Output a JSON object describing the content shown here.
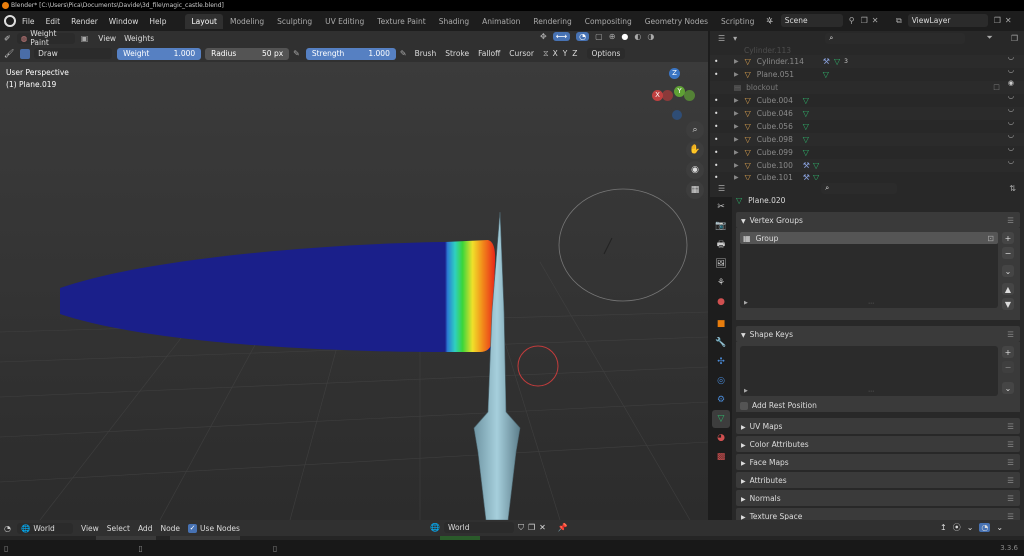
{
  "window": {
    "title": "Blender* [C:\\Users\\Pica\\Documents\\Davide\\3d_file\\magic_castle.blend]"
  },
  "menus": [
    "File",
    "Edit",
    "Render",
    "Window",
    "Help"
  ],
  "workspaces": [
    "Layout",
    "Modeling",
    "Sculpting",
    "UV Editing",
    "Texture Paint",
    "Shading",
    "Animation",
    "Rendering",
    "Compositing",
    "Geometry Nodes",
    "Scripting"
  ],
  "active_workspace": "Layout",
  "scene": "Scene",
  "view_layer": "ViewLayer",
  "toolbar": {
    "mode": "Weight Paint",
    "view": "View",
    "weights": "Weights"
  },
  "tool_settings": {
    "brush_name": "Draw",
    "weight_label": "Weight",
    "weight_value": "1.000",
    "radius_label": "Radius",
    "radius_value": "50 px",
    "strength_label": "Strength",
    "strength_value": "1.000",
    "brush": "Brush",
    "stroke": "Stroke",
    "falloff": "Falloff",
    "cursor": "Cursor",
    "x": "X",
    "y": "Y",
    "z": "Z",
    "options": "Options"
  },
  "viewport": {
    "perspective": "User Perspective",
    "object": "(1) Plane.019"
  },
  "gizmo": {
    "z": "Z",
    "y": "Y",
    "x": "X"
  },
  "outliner": {
    "rows": [
      {
        "name": "Cylinder.114",
        "extra": "3"
      },
      {
        "name": "Plane.051",
        "extra": ""
      },
      {
        "name": "blockout",
        "collection": true
      },
      {
        "name": "Cube.004"
      },
      {
        "name": "Cube.046"
      },
      {
        "name": "Cube.056"
      },
      {
        "name": "Cube.098"
      },
      {
        "name": "Cube.099"
      },
      {
        "name": "Cube.100"
      },
      {
        "name": "Cube.101"
      }
    ]
  },
  "properties": {
    "object_name": "Plane.020",
    "vertex_groups": "Vertex Groups",
    "group_item": "Group",
    "shape_keys": "Shape Keys",
    "add_rest_position": "Add Rest Position",
    "collapsed": [
      "UV Maps",
      "Color Attributes",
      "Face Maps",
      "Attributes",
      "Normals",
      "Texture Space"
    ]
  },
  "bottom": {
    "world": "World",
    "view": "View",
    "select": "Select",
    "add": "Add",
    "node": "Node",
    "use_nodes": "Use Nodes",
    "world_field": "World"
  },
  "status": {
    "version": "3.3.6"
  },
  "colors": {
    "accent": "#5680c2",
    "orange": "#e87d0d",
    "mesh_green": "#2fb36b"
  }
}
